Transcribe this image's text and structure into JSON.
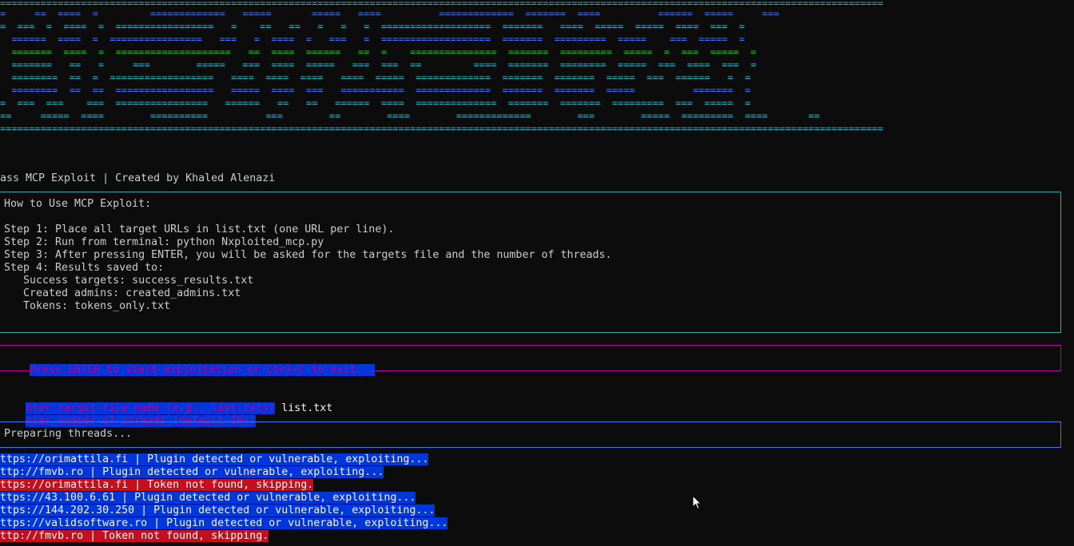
{
  "banner": {
    "lines": [
      "=========================================================================================================================================================",
      "=     ==  ====  =         =============   =====       =====   ====          =============  =======  ====          ======  =====     ===",
      "=  ===  =  ====  =  =================   =    ==   ==   =   =   =  ===================  =======   ====  =====  =====  ====  ===  =",
      "  ======  ====  =  ================   ===   =  ====  =   ===   =  ===================  =======  =========  =====    ===  =====  =",
      "  =======  ====  =  ====================   ==  ====  ======   ==  =    ===============  =======  =========  =====  =  ===  =====  =",
      "  =======   ==   =     ===        =====   ===  ====  =====   ===  ===  ==         ====  =======  ========  =====  ===  ====  ===  =",
      "  ========  ==  =  ==================   ====  ====  ====   ====  =====  =============  =======  =======  =====  ===  ======   =  =",
      "  ========  ==  ==  =================   =====  ====  ===   ===========  =============  =======  =======  =====          =======  =",
      "=  ===  ===    ===  ================   ======   ==   ==   ======  ====  ==============  =======  =======  =========  ===  =====  =",
      "==     =====  ====        ==========          ===        ==        ====        =============        ===        =====  =========  ====       ==",
      "========================================================================================================================================================="
    ]
  },
  "credit": "ass MCP Exploit | Created by Khaled Alenazi",
  "howto": {
    "title": "How to Use MCP Exploit:",
    "step1": "Step 1: Place all target URLs in list.txt (one URL per line).",
    "step2": "Step 2: Run from terminal: python Nxploited_mcp.py",
    "step3": "Step 3: After pressing ENTER, you will be asked for the targets file and the number of threads.",
    "step4": "Step 4: Results saved to:",
    "success": "   Success targets: success_results.txt",
    "admins": "   Created admins: created_admins.txt",
    "tokens": "   Tokens: tokens_only.txt"
  },
  "prompt_start": "Press ENTER to start exploitation or Ctrl+C to exit...",
  "prompt_file_label": "nter target file name (e.g., list.txt):",
  "prompt_file_value": " list.txt",
  "prompt_threads_label": "nter number of threads (default 10):",
  "preparing": "Preparing threads...",
  "log": [
    {
      "text": "ttps://orimattila.fi | Plugin detected or vulnerable, exploiting...",
      "status": "info"
    },
    {
      "text": "ttp://fmvb.ro | Plugin detected or vulnerable, exploiting...",
      "status": "info"
    },
    {
      "text": "ttps://orimattila.fi | Token not found, skipping.",
      "status": "error"
    },
    {
      "text": "ttps://43.100.6.61 | Plugin detected or vulnerable, exploiting...",
      "status": "info"
    },
    {
      "text": "ttps://144.202.30.250 | Plugin detected or vulnerable, exploiting...",
      "status": "info"
    },
    {
      "text": "ttps://validsoftware.ro | Plugin detected or vulnerable, exploiting...",
      "status": "info"
    },
    {
      "text": "ttp://fmvb.ro | Token not found, skipping.",
      "status": "error"
    }
  ],
  "colors": {
    "background": "#0c0c0c",
    "cyan": "#3aa7b4",
    "magenta": "#b4009e",
    "blue_highlight": "#0037da",
    "red_highlight": "#c50f1f"
  },
  "icons": {
    "cursor": "mouse-pointer-icon"
  }
}
